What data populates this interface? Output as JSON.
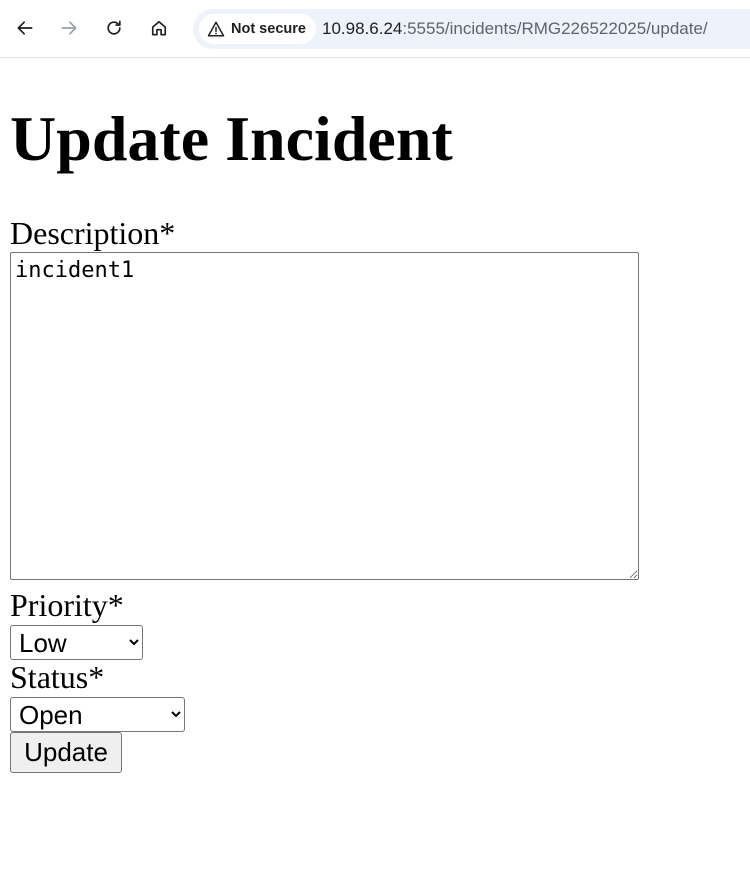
{
  "browser": {
    "security_label": "Not secure",
    "url_host": "10.98.6.24",
    "url_rest": ":5555/incidents/RMG226522025/update/",
    "back_icon": "back-arrow-icon",
    "forward_icon": "forward-arrow-icon",
    "reload_icon": "reload-icon",
    "home_icon": "home-icon",
    "warning_icon": "warning-triangle-icon"
  },
  "form": {
    "title": "Update Incident",
    "description_label": "Description*",
    "description_value": "incident1",
    "priority_label": "Priority*",
    "priority_value": "Low",
    "status_label": "Status*",
    "status_value": "Open",
    "submit_label": "Update"
  }
}
